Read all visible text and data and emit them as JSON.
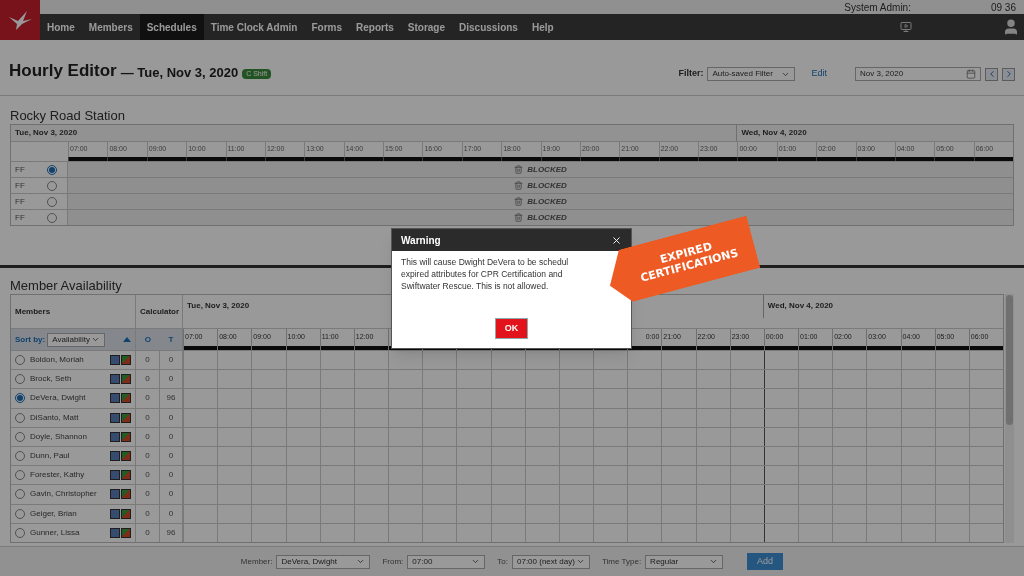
{
  "app_header": {
    "admin_label": "System Admin:",
    "time": "09 36"
  },
  "nav": [
    {
      "label": "Home",
      "selected": false
    },
    {
      "label": "Members",
      "selected": false
    },
    {
      "label": "Schedules",
      "selected": true
    },
    {
      "label": "Time Clock Admin",
      "selected": false
    },
    {
      "label": "Forms",
      "selected": false
    },
    {
      "label": "Reports",
      "selected": false
    },
    {
      "label": "Storage",
      "selected": false
    },
    {
      "label": "Discussions",
      "selected": false
    },
    {
      "label": "Help",
      "selected": false
    }
  ],
  "page": {
    "title": "Hourly Editor",
    "date": "— Tue, Nov 3, 2020",
    "badge": "C Shift"
  },
  "filter": {
    "label": "Filter:",
    "value": "Auto-saved Filter",
    "edit_link": "Edit",
    "date_value": "Nov 3, 2020"
  },
  "station": {
    "title": "Rocky Road Station",
    "day1": "Tue, Nov 3, 2020",
    "day2": "Wed, Nov 4, 2020",
    "hours": [
      "07:00",
      "08:00",
      "09:00",
      "10:00",
      "11:00",
      "12:00",
      "13:00",
      "14:00",
      "15:00",
      "16:00",
      "17:00",
      "18:00",
      "19:00",
      "20:00",
      "21:00",
      "22:00",
      "23:00",
      "00:00",
      "01:00",
      "02:00",
      "03:00",
      "04:00",
      "05:00",
      "06:00"
    ],
    "rows": [
      {
        "label": "FF",
        "selected": true,
        "status": "BLOCKED"
      },
      {
        "label": "FF",
        "selected": false,
        "status": "BLOCKED"
      },
      {
        "label": "FF",
        "selected": false,
        "status": "BLOCKED"
      },
      {
        "label": "FF",
        "selected": false,
        "status": "BLOCKED"
      }
    ]
  },
  "availability": {
    "title": "Member Availability",
    "members_header": "Members",
    "calculator_header": "Calculator",
    "sort_label": "Sort by:",
    "sort_value": "Availability",
    "col_o": "O",
    "col_t": "T",
    "day1": "Tue, Nov 3, 2020",
    "day2": "Wed, Nov 4, 2020",
    "hours_left": [
      "07:00",
      "08:00",
      "09:00",
      "10:00",
      "11:00",
      "12:00"
    ],
    "hours_right": [
      "0:00",
      "21:00",
      "22:00",
      "23:00",
      "00:00",
      "01:00",
      "02:00",
      "03:00",
      "04:00",
      "05:00",
      "06:00"
    ],
    "members": [
      {
        "name": "Boldon, Moriah",
        "selected": false,
        "o": "0",
        "t": "0"
      },
      {
        "name": "Brock, Seth",
        "selected": false,
        "o": "0",
        "t": "0"
      },
      {
        "name": "DeVera, Dwight",
        "selected": true,
        "o": "0",
        "t": "96"
      },
      {
        "name": "DiSanto, Matt",
        "selected": false,
        "o": "0",
        "t": "0"
      },
      {
        "name": "Doyle, Shannon",
        "selected": false,
        "o": "0",
        "t": "0"
      },
      {
        "name": "Dunn, Paul",
        "selected": false,
        "o": "0",
        "t": "0"
      },
      {
        "name": "Forester, Kathy",
        "selected": false,
        "o": "0",
        "t": "0"
      },
      {
        "name": "Gavin, Christopher",
        "selected": false,
        "o": "0",
        "t": "0"
      },
      {
        "name": "Geiger, Brian",
        "selected": false,
        "o": "0",
        "t": "0"
      },
      {
        "name": "Gunner, Lissa",
        "selected": false,
        "o": "0",
        "t": "96"
      }
    ]
  },
  "dialog": {
    "title": "Warning",
    "message_lines": [
      "This will cause Dwight DeVera to be schedul",
      "expired attributes for CPR Certification and",
      "Swiftwater Rescue. This is not allowed."
    ],
    "ok": "OK"
  },
  "callout": {
    "lines": [
      "EXPIRED",
      "CERTIFICATIONS"
    ]
  },
  "bottom_bar": {
    "fields": [
      {
        "label": "Member:",
        "value": "DeVera, Dwight"
      },
      {
        "label": "From:",
        "value": "07:00"
      },
      {
        "label": "To:",
        "value": "07:00 (next day)"
      },
      {
        "label": "Time Type:",
        "value": "Regular"
      }
    ],
    "add": "Add"
  }
}
